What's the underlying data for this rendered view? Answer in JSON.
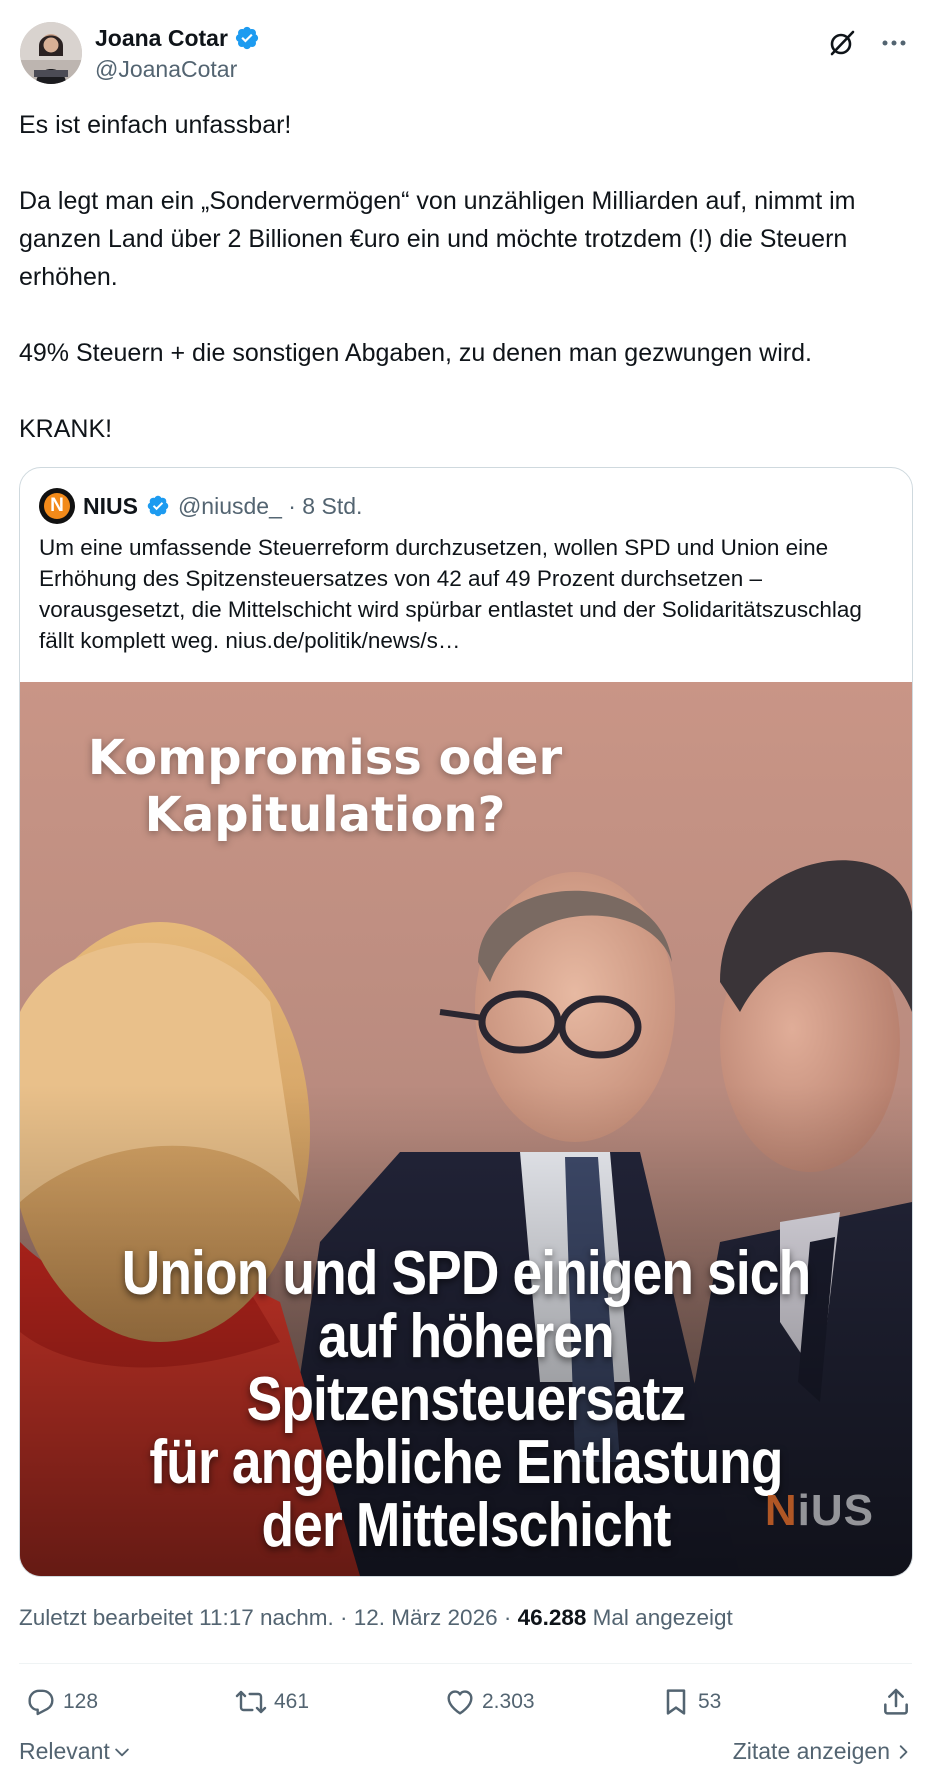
{
  "author": {
    "display_name": "Joana Cotar",
    "handle": "@JoanaCotar",
    "verified": true
  },
  "header_icons": [
    "grok-icon",
    "more-icon"
  ],
  "tweet": {
    "paragraphs": [
      "Es ist einfach unfassbar!",
      "Da legt man ein „Sondervermögen“ von unzähligen Milliarden auf, nimmt im ganzen Land über 2 Billionen €uro ein und möchte trotzdem (!) die Steuern erhöhen.",
      "49% Steuern + die sonstigen Abgaben, zu denen man gezwungen wird.",
      "KRANK!"
    ]
  },
  "quote": {
    "logo_letter": "N",
    "name": "NIUS",
    "handle_time": "@niusde_ · 8 Std.",
    "text": "Um eine umfassende Steuerreform durchzusetzen, wollen SPD und Union eine Erhöhung des Spitzensteuersatzes von 42 auf 49 Prozent durchsetzen – vorausgesetzt, die Mittelschicht wird spürbar entlastet und der Solidaritätszuschlag fällt komplett weg. nius.de/politik/news/s…",
    "media": {
      "headline_line1": "Kompromiss oder",
      "headline_line2": "Kapitulation?",
      "subline_line1": "Union und SPD einigen sich",
      "subline_line2": "auf höheren Spitzensteuersatz",
      "subline_line3": "für angebliche Entlastung",
      "subline_line4": "der Mittelschicht",
      "watermark_n": "N",
      "watermark_rest": "iUS"
    }
  },
  "meta": {
    "edited": "Zuletzt bearbeitet 11:17 nachm. · 12. März 2026 · ",
    "views_count": "46.288",
    "views_label": " Mal angezeigt"
  },
  "actions": {
    "replies": "128",
    "reposts": "461",
    "likes": "2.303",
    "bookmarks": "53"
  },
  "footer": {
    "sort_label": "Relevant",
    "quotes_label": "Zitate anzeigen"
  },
  "colors": {
    "text_primary": "#0f1419",
    "text_secondary": "#536471",
    "verified_blue": "#1d9bf0",
    "border": "#cfd9de"
  }
}
